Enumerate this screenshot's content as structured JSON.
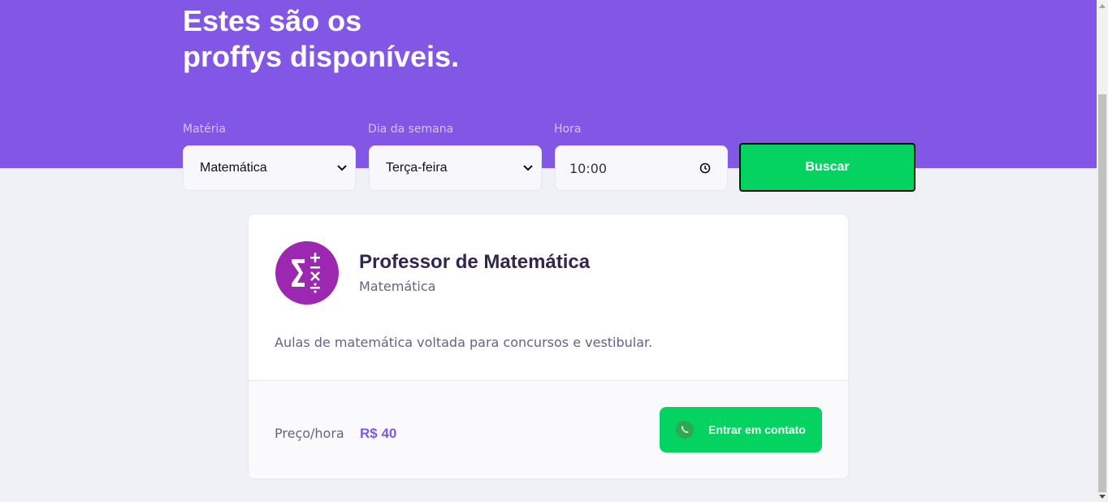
{
  "header": {
    "title_line1": "Estes são os",
    "title_line2": "proffys disponíveis."
  },
  "filters": {
    "subject_label": "Matéria",
    "subject_value": "Matemática",
    "weekday_label": "Dia da semana",
    "weekday_value": "Terça-feira",
    "time_label": "Hora",
    "time_value": "10:00",
    "search_label": "Buscar"
  },
  "teacher_card": {
    "avatar_icon": "math-operators-icon",
    "name": "Professor de Matemática",
    "subject": "Matemática",
    "bio": "Aulas de matemática voltada para concursos e vestibular.",
    "price_label": "Preço/hora",
    "price_value": "R$ 40",
    "contact_label": "Entrar em contato",
    "contact_icon": "whatsapp-icon"
  },
  "colors": {
    "primary": "#8257e5",
    "success": "#04d361",
    "background": "#f0f0f7"
  }
}
